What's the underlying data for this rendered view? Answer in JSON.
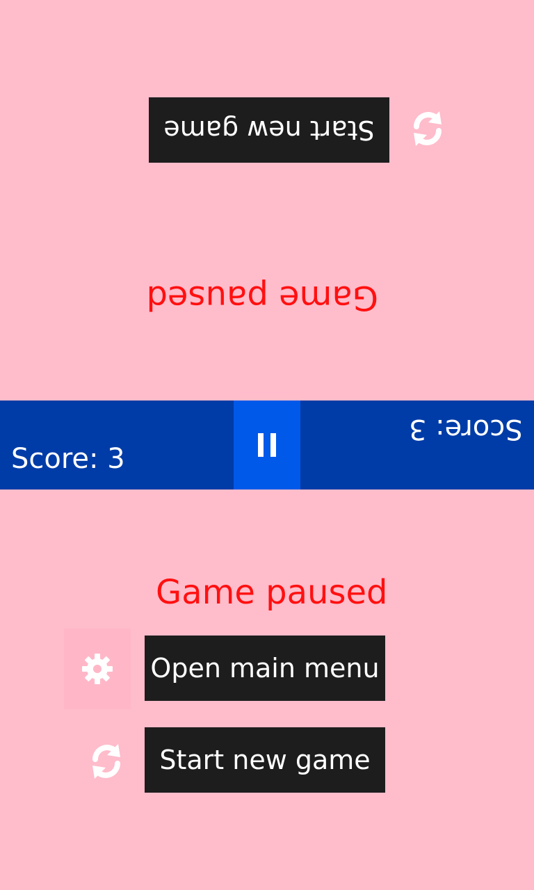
{
  "app": {
    "background_color": "#ffbccb",
    "bar_color": "#003ca7",
    "pause_color": "#0059e8",
    "button_color": "#1d1d1d",
    "title_color": "#ff1010"
  },
  "top_player": {
    "title": "Game paused",
    "start_label": "Start new game",
    "score_text": "Score: 3",
    "icons": {
      "restart": "refresh-icon"
    }
  },
  "bottom_player": {
    "title": "Game paused",
    "menu_label": "Open main menu",
    "start_label": "Start new game",
    "score_text": "Score: 3",
    "icons": {
      "settings": "gear-icon",
      "restart": "refresh-icon"
    }
  },
  "pause_control": {
    "icon": "pause-icon"
  }
}
